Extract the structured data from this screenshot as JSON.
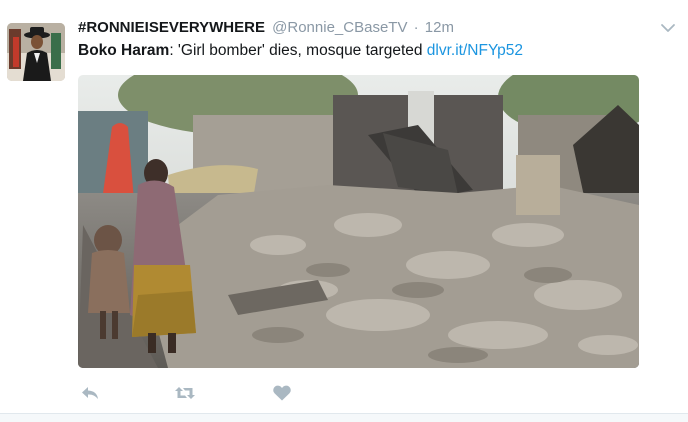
{
  "tweet": {
    "author_name": "#RONNIEISEVERYWHERE",
    "author_handle": "@Ronnie_CBaseTV",
    "separator": "·",
    "timestamp": "12m",
    "text_bold": "Boko Haram",
    "text_body": ": 'Girl bomber' dies, mosque targeted ",
    "link_text": "dlvr.it/NFYp52"
  },
  "icons": {
    "menu": "chevron-down-icon",
    "reply": "reply-icon",
    "retweet": "retweet-icon",
    "like": "heart-icon"
  },
  "colors": {
    "link": "#1b95e0",
    "icon": "#aab8c2",
    "muted": "#8a98a5"
  }
}
